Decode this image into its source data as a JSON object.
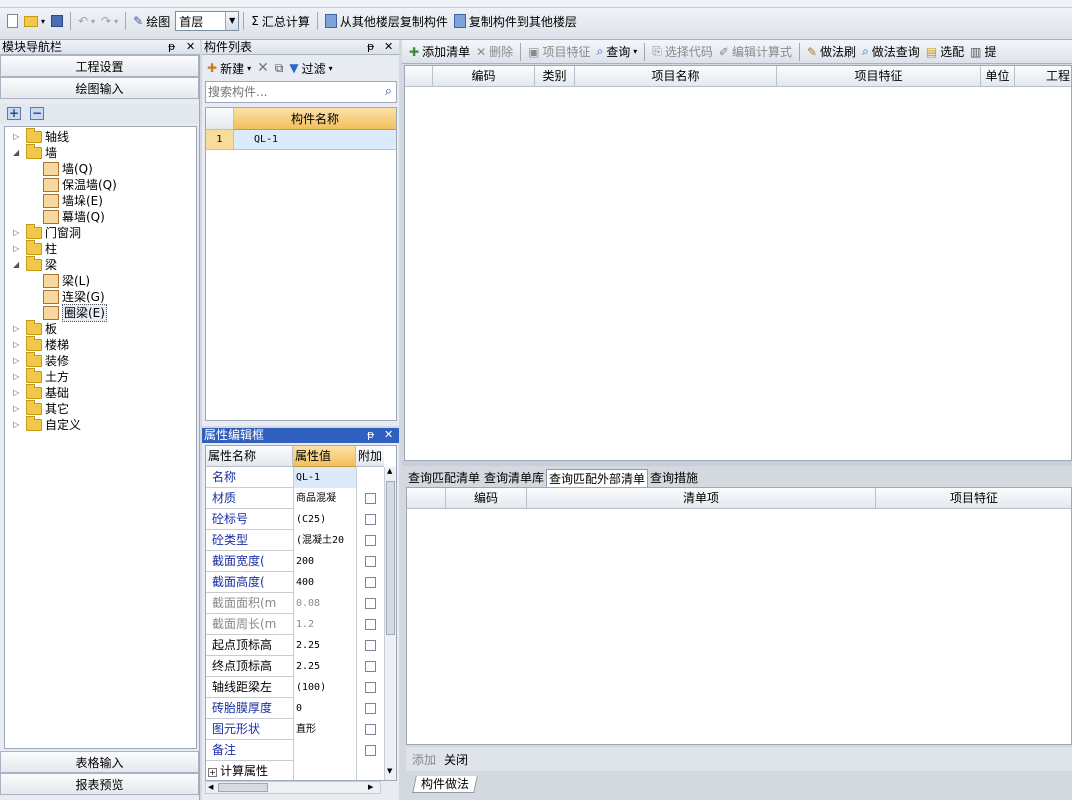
{
  "toolbar": {
    "draw_label": "绘图",
    "floor_value": "首层",
    "sum_label": "汇总计算",
    "copy_from_label": "从其他楼层复制构件",
    "copy_to_label": "复制构件到其他楼层"
  },
  "nav": {
    "title": "模块导航栏",
    "project_settings": "工程设置",
    "draw_input": "绘图输入",
    "table_input": "表格输入",
    "report_preview": "报表预览",
    "tree": [
      {
        "label": "轴线",
        "level": 0,
        "expanded": false
      },
      {
        "label": "墙",
        "level": 0,
        "expanded": true
      },
      {
        "label": "墙(Q)",
        "level": 1
      },
      {
        "label": "保温墙(Q)",
        "level": 1
      },
      {
        "label": "墙垛(E)",
        "level": 1
      },
      {
        "label": "幕墙(Q)",
        "level": 1
      },
      {
        "label": "门窗洞",
        "level": 0,
        "expanded": false
      },
      {
        "label": "柱",
        "level": 0,
        "expanded": false
      },
      {
        "label": "梁",
        "level": 0,
        "expanded": true
      },
      {
        "label": "梁(L)",
        "level": 1
      },
      {
        "label": "连梁(G)",
        "level": 1
      },
      {
        "label": "圈梁(E)",
        "level": 1,
        "selected": true
      },
      {
        "label": "板",
        "level": 0,
        "expanded": false
      },
      {
        "label": "楼梯",
        "level": 0,
        "expanded": false
      },
      {
        "label": "装修",
        "level": 0,
        "expanded": false
      },
      {
        "label": "土方",
        "level": 0,
        "expanded": false
      },
      {
        "label": "基础",
        "level": 0,
        "expanded": false
      },
      {
        "label": "其它",
        "level": 0,
        "expanded": false
      },
      {
        "label": "自定义",
        "level": 0,
        "expanded": false
      }
    ]
  },
  "component_list": {
    "title": "构件列表",
    "new_label": "新建",
    "filter_label": "过滤",
    "search_placeholder": "搜索构件...",
    "col_name": "构件名称",
    "rows": [
      {
        "index": "1",
        "name": "QL-1"
      }
    ]
  },
  "props": {
    "title": "属性编辑框",
    "col_name": "属性名称",
    "col_value": "属性值",
    "col_extra": "附加",
    "rows": [
      {
        "name": "名称",
        "value": "QL-1",
        "style": "blue",
        "chk": false
      },
      {
        "name": "材质",
        "value": "商品混凝",
        "style": "blue",
        "chk": true
      },
      {
        "name": "砼标号",
        "value": "(C25)",
        "style": "blue",
        "chk": true
      },
      {
        "name": "砼类型",
        "value": "(混凝土20",
        "style": "blue",
        "chk": true
      },
      {
        "name": "截面宽度(",
        "value": "200",
        "style": "blue",
        "chk": true
      },
      {
        "name": "截面高度(",
        "value": "400",
        "style": "blue",
        "chk": true
      },
      {
        "name": "截面面积(m",
        "value": "0.08",
        "style": "gray",
        "chk": true
      },
      {
        "name": "截面周长(m",
        "value": "1.2",
        "style": "gray",
        "chk": true
      },
      {
        "name": "起点顶标高",
        "value": "2.25",
        "style": "normal",
        "chk": true
      },
      {
        "name": "终点顶标高",
        "value": "2.25",
        "style": "normal",
        "chk": true
      },
      {
        "name": "轴线距梁左",
        "value": "(100)",
        "style": "normal",
        "chk": true
      },
      {
        "name": "砖胎膜厚度",
        "value": "0",
        "style": "blue",
        "chk": true
      },
      {
        "name": "图元形状",
        "value": "直形",
        "style": "blue",
        "chk": true
      },
      {
        "name": "备注",
        "value": "",
        "style": "blue",
        "chk": true
      },
      {
        "name": "计算属性",
        "value": "",
        "style": "group",
        "chk": false
      }
    ]
  },
  "right_toolbar": {
    "add_list": "添加清单",
    "delete": "删除",
    "item_feature": "项目特征",
    "query": "查询",
    "select_code": "选择代码",
    "edit_formula": "编辑计算式",
    "method_brush": "做法刷",
    "method_query": "做法查询",
    "match": "选配",
    "extract": "提"
  },
  "top_grid": {
    "cols": [
      "编码",
      "类别",
      "项目名称",
      "项目特征",
      "单位",
      "工程"
    ]
  },
  "bottom_tabs": [
    "查询匹配清单",
    "查询清单库",
    "查询匹配外部清单",
    "查询措施"
  ],
  "bottom_grid": {
    "cols": [
      "编码",
      "清单项",
      "项目特征"
    ]
  },
  "bottom_actions": {
    "add": "添加",
    "close": "关闭"
  },
  "footer_tab": "构件做法"
}
